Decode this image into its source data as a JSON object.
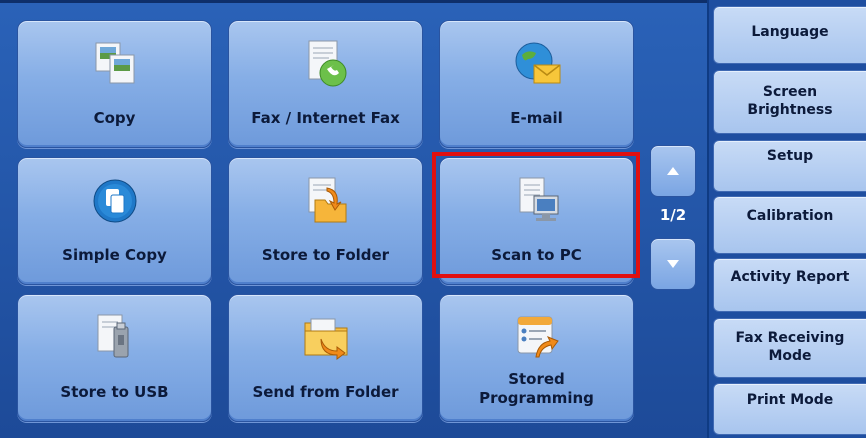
{
  "tiles": [
    {
      "label": "Copy",
      "icon": "copy-icon"
    },
    {
      "label": "Fax / Internet Fax",
      "icon": "fax-icon"
    },
    {
      "label": "E-mail",
      "icon": "email-icon"
    },
    {
      "label": "Simple Copy",
      "icon": "simple-copy-icon"
    },
    {
      "label": "Store to Folder",
      "icon": "store-folder-icon"
    },
    {
      "label": "Scan to PC",
      "icon": "scan-to-pc-icon"
    },
    {
      "label": "Store to USB",
      "icon": "usb-icon"
    },
    {
      "label": "Send from Folder",
      "icon": "send-folder-icon"
    },
    {
      "label_line1": "Stored",
      "label_line2": "Programming",
      "icon": "stored-programming-icon"
    }
  ],
  "pager": {
    "indicator": "1/2"
  },
  "side_menu": {
    "language": "Language",
    "screen_brightness_line1": "Screen",
    "screen_brightness_line2": "Brightness",
    "setup": "Setup",
    "calibration": "Calibration",
    "activity_report": "Activity Report",
    "fax_receiving_line1": "Fax Receiving",
    "fax_receiving_line2": "Mode",
    "print_mode": "Print Mode"
  },
  "colors": {
    "highlight": "#e01010",
    "tile": "#86aee6",
    "background": "#1f4f9f"
  }
}
